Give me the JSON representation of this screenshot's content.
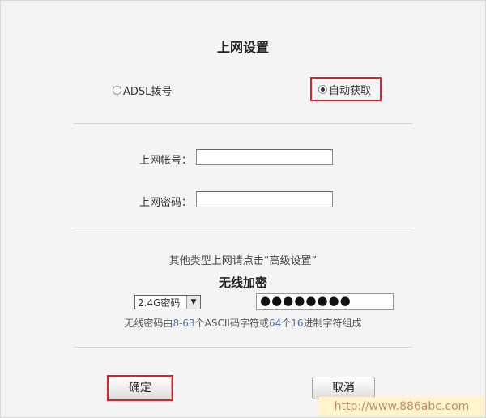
{
  "title": "上网设置",
  "connection_mode": {
    "options": [
      {
        "label": "ADSL拨号",
        "selected": false
      },
      {
        "label": "自动获取",
        "selected": true
      }
    ]
  },
  "account": {
    "label": "上网帐号：",
    "value": ""
  },
  "password": {
    "label": "上网密码：",
    "value": ""
  },
  "hint": "其他类型上网请点击“高级设置”",
  "wireless": {
    "subtitle": "无线加密",
    "band_select": {
      "value": "2.4G密码"
    },
    "password_masked": "●●●●●●●●",
    "note_parts": [
      "无线密码由",
      "8-63",
      "个ASCII码字符或",
      "64",
      "个",
      "16",
      "进制字符组成"
    ]
  },
  "buttons": {
    "ok": "确定",
    "cancel": "取消"
  },
  "watermark": "http://www.886abc.com",
  "colors": {
    "highlight": "#e0202a",
    "note_numbers": "#4d6fb0",
    "watermark_bg": "#fff5c8"
  }
}
